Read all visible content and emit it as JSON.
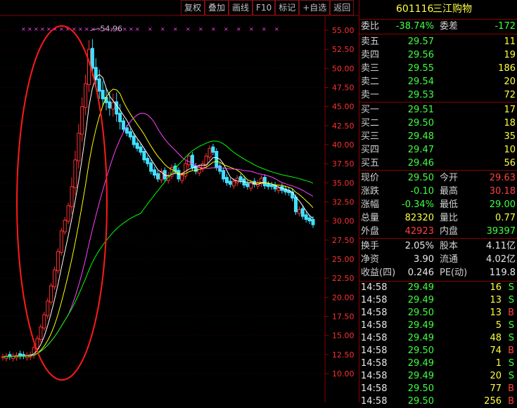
{
  "toolbar": [
    "复权",
    "叠加",
    "画线",
    "F10",
    "标记",
    "+自选",
    "返回"
  ],
  "stock": {
    "code": "601116",
    "name": "三江购物"
  },
  "peak_label": "54.96",
  "y_ticks": [
    "55.00",
    "52.50",
    "50.00",
    "47.50",
    "45.00",
    "42.50",
    "40.00",
    "37.50",
    "35.00",
    "32.50",
    "30.00",
    "27.50",
    "25.00",
    "22.50",
    "20.00",
    "17.50",
    "15.00",
    "12.50",
    "10.00"
  ],
  "weibi": {
    "l1": "委比",
    "v1": "-38.74%",
    "l2": "委差",
    "v2": "-172"
  },
  "asks": [
    {
      "label": "卖五",
      "price": "29.57",
      "vol": "11"
    },
    {
      "label": "卖四",
      "price": "29.56",
      "vol": "19"
    },
    {
      "label": "卖三",
      "price": "29.55",
      "vol": "186"
    },
    {
      "label": "卖二",
      "price": "29.54",
      "vol": "20"
    },
    {
      "label": "卖一",
      "price": "29.53",
      "vol": "72"
    }
  ],
  "bids": [
    {
      "label": "买一",
      "price": "29.51",
      "vol": "17"
    },
    {
      "label": "买二",
      "price": "29.50",
      "vol": "18"
    },
    {
      "label": "买三",
      "price": "29.48",
      "vol": "35"
    },
    {
      "label": "买四",
      "price": "29.47",
      "vol": "10"
    },
    {
      "label": "买五",
      "price": "29.46",
      "vol": "56"
    }
  ],
  "quote": [
    {
      "l1": "现价",
      "v1": "29.50",
      "c1": "green",
      "l2": "今开",
      "v2": "29.63",
      "c2": "red"
    },
    {
      "l1": "涨跌",
      "v1": "-0.10",
      "c1": "green",
      "l2": "最高",
      "v2": "30.18",
      "c2": "red"
    },
    {
      "l1": "涨幅",
      "v1": "-0.34%",
      "c1": "green",
      "l2": "最低",
      "v2": "29.00",
      "c2": "green"
    },
    {
      "l1": "总量",
      "v1": "82320",
      "c1": "yellow",
      "l2": "量比",
      "v2": "0.77",
      "c2": "yellow"
    },
    {
      "l1": "外盘",
      "v1": "42923",
      "c1": "red",
      "l2": "内盘",
      "v2": "39397",
      "c2": "green"
    }
  ],
  "fundamentals": [
    {
      "l1": "换手",
      "v1": "2.05%",
      "l2": "股本",
      "v2": "4.11亿"
    },
    {
      "l1": "净资",
      "v1": "3.90",
      "l2": "流通",
      "v2": "4.02亿"
    },
    {
      "l1": "收益(四)",
      "v1": "0.246",
      "l2": "PE(动)",
      "v2": "119.8"
    }
  ],
  "ticks": [
    {
      "time": "14:58",
      "price": "29.49",
      "vol": "16",
      "side": "S"
    },
    {
      "time": "14:58",
      "price": "29.49",
      "vol": "13",
      "side": "S"
    },
    {
      "time": "14:58",
      "price": "29.50",
      "vol": "13",
      "side": "B"
    },
    {
      "time": "14:58",
      "price": "29.49",
      "vol": "5",
      "side": "S"
    },
    {
      "time": "14:58",
      "price": "29.49",
      "vol": "48",
      "side": "S"
    },
    {
      "time": "14:58",
      "price": "29.50",
      "vol": "74",
      "side": "B"
    },
    {
      "time": "14:58",
      "price": "29.49",
      "vol": "1",
      "side": "S"
    },
    {
      "time": "14:58",
      "price": "29.49",
      "vol": "20",
      "side": "S"
    },
    {
      "time": "14:58",
      "price": "29.50",
      "vol": "77",
      "side": "B"
    },
    {
      "time": "14:58",
      "price": "29.50",
      "vol": "256",
      "side": "B"
    }
  ],
  "colors": {
    "up": "#ff3030",
    "down": "#40e0ff",
    "ma5": "#ffffff",
    "ma10": "#ffff00",
    "ma20": "#ff40ff",
    "ma60": "#00ff00",
    "ellipse": "#ff1a1a",
    "grid": "#8b0000"
  },
  "chart_data": {
    "type": "candlestick",
    "y_range": [
      9,
      56
    ],
    "closes": [
      12.2,
      12.3,
      12.2,
      12.3,
      12.4,
      12.3,
      12.3,
      12.4,
      12.5,
      13.4,
      14.6,
      16.1,
      17.7,
      19.5,
      21.5,
      23.6,
      26.0,
      28.7,
      30.1,
      32.0,
      34.5,
      38.0,
      41.5,
      45.0,
      48.0,
      52.5,
      50.0,
      48.5,
      47.0,
      46.0,
      45.5,
      44.8,
      45.5,
      44.0,
      43.0,
      42.0,
      41.5,
      41.0,
      40.0,
      39.5,
      39.0,
      38.0,
      37.5,
      36.5,
      36.0,
      35.5,
      36.5,
      35.5,
      36.0,
      37.0,
      36.5,
      35.5,
      36.0,
      37.5,
      38.5,
      37.0,
      36.5,
      37.0,
      37.5,
      38.5,
      39.5,
      39.0,
      37.0,
      36.5,
      35.5,
      35.0,
      34.8,
      35.2,
      35.6,
      35.3,
      34.7,
      34.5,
      35.0,
      34.8,
      35.0,
      35.6,
      34.6,
      34.5,
      34.5,
      34.2,
      34.3,
      34.0,
      33.8,
      33.7,
      33.0,
      31.2,
      31.5,
      30.6,
      30.2,
      30.0,
      29.5
    ]
  }
}
